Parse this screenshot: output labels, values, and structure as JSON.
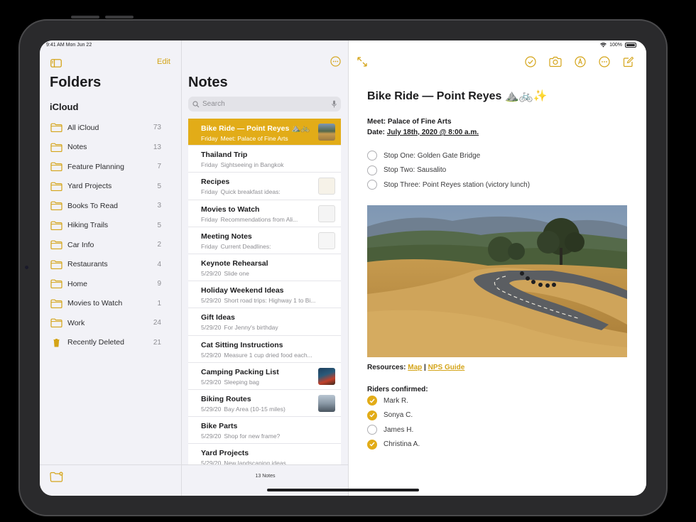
{
  "status_bar": {
    "time": "9:41 AM   Mon Jun 22",
    "battery": "100%"
  },
  "colors": {
    "accent": "#e2ac18",
    "sidebar_bg": "#f2f2f7"
  },
  "folders": {
    "edit_label": "Edit",
    "title": "Folders",
    "section": "iCloud",
    "items": [
      {
        "name": "All iCloud",
        "count": "73",
        "icon": "folder-icon"
      },
      {
        "name": "Notes",
        "count": "13",
        "icon": "folder-icon"
      },
      {
        "name": "Feature Planning",
        "count": "7",
        "icon": "folder-icon"
      },
      {
        "name": "Yard Projects",
        "count": "5",
        "icon": "folder-icon"
      },
      {
        "name": "Books To Read",
        "count": "3",
        "icon": "folder-icon"
      },
      {
        "name": "Hiking Trails",
        "count": "5",
        "icon": "folder-icon"
      },
      {
        "name": "Car Info",
        "count": "2",
        "icon": "folder-icon"
      },
      {
        "name": "Restaurants",
        "count": "4",
        "icon": "folder-icon"
      },
      {
        "name": "Home",
        "count": "9",
        "icon": "folder-icon"
      },
      {
        "name": "Movies to Watch",
        "count": "1",
        "icon": "folder-icon"
      },
      {
        "name": "Work",
        "count": "24",
        "icon": "folder-icon"
      },
      {
        "name": "Recently Deleted",
        "count": "21",
        "icon": "trash-icon"
      }
    ]
  },
  "notes": {
    "title": "Notes",
    "search_placeholder": "Search",
    "count_label": "13 Notes",
    "items": [
      {
        "title": "Bike Ride — Point Reyes ⛰️🚲",
        "date": "Friday",
        "preview": "Meet: Palace of Fine Arts",
        "thumb": "bike-photo"
      },
      {
        "title": "Thailand Trip",
        "date": "Friday",
        "preview": "Sightseeing in Bangkok",
        "thumb": ""
      },
      {
        "title": "Recipes",
        "date": "Friday",
        "preview": "Quick breakfast ideas:",
        "thumb": "recipe-sketch"
      },
      {
        "title": "Movies to Watch",
        "date": "Friday",
        "preview": "Recommendations from Ali...",
        "thumb": "doodle"
      },
      {
        "title": "Meeting Notes",
        "date": "Friday",
        "preview": "Current Deadlines:",
        "thumb": "table-sketch"
      },
      {
        "title": "Keynote Rehearsal",
        "date": "5/29/20",
        "preview": "Slide one",
        "thumb": ""
      },
      {
        "title": "Holiday Weekend Ideas",
        "date": "5/29/20",
        "preview": "Short road trips: Highway 1 to Bi...",
        "thumb": ""
      },
      {
        "title": "Gift Ideas",
        "date": "5/29/20",
        "preview": "For Jenny's birthday",
        "thumb": ""
      },
      {
        "title": "Cat Sitting Instructions",
        "date": "5/29/20",
        "preview": "Measure 1 cup dried food each...",
        "thumb": ""
      },
      {
        "title": "Camping Packing List",
        "date": "5/29/20",
        "preview": "Sleeping bag",
        "thumb": "camping-photo"
      },
      {
        "title": "Biking Routes",
        "date": "5/29/20",
        "preview": "Bay Area (10-15 miles)",
        "thumb": "biker-photo"
      },
      {
        "title": "Bike Parts",
        "date": "5/29/20",
        "preview": "Shop for new frame?",
        "thumb": ""
      },
      {
        "title": "Yard Projects",
        "date": "5/29/20",
        "preview": "New landscaping ideas",
        "thumb": ""
      }
    ]
  },
  "editor": {
    "title": "Bike Ride — Point Reyes ⛰️🚲✨",
    "meet_line": "Meet: Palace of Fine Arts",
    "date_prefix": "Date: ",
    "date_value": "July 18th, 2020 @ 8:00 a.m.",
    "stops": [
      {
        "text": "Stop One: Golden Gate Bridge",
        "done": false
      },
      {
        "text": "Stop Two: Sausalito",
        "done": false
      },
      {
        "text": "Stop Three: Point Reyes station (victory lunch)",
        "done": false
      }
    ],
    "resources_label": "Resources: ",
    "resources_link1": "Map",
    "resources_sep": " | ",
    "resources_link2": "NPS Guide",
    "riders_title": "Riders confirmed:",
    "riders": [
      {
        "text": "Mark R.",
        "done": true
      },
      {
        "text": "Sonya C.",
        "done": true
      },
      {
        "text": "James H.",
        "done": false
      },
      {
        "text": "Christina A.",
        "done": true
      }
    ]
  }
}
